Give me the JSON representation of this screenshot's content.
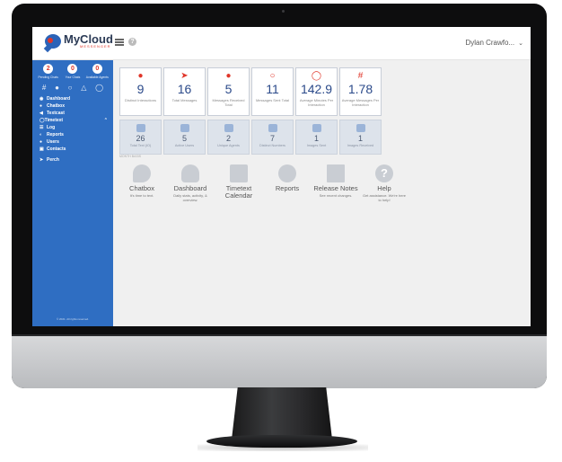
{
  "app": {
    "logo_title": "MyCloud",
    "logo_subtitle": "MESSENGER",
    "user_name": "Dylan Crawfo..."
  },
  "sidebar": {
    "counters": [
      {
        "value": "2",
        "label": "Pending Chats"
      },
      {
        "value": "0",
        "label": "Your Chats"
      },
      {
        "value": "0",
        "label": "Available Agents"
      }
    ],
    "icons": [
      "hash-icon",
      "user-icon",
      "chat-icon",
      "warning-icon",
      "clock-icon"
    ],
    "items": [
      {
        "label": "Dashboard",
        "icon": "dashboard-icon"
      },
      {
        "label": "Chatbox",
        "icon": "chat-icon"
      },
      {
        "label": "Textcast",
        "icon": "megaphone-icon"
      },
      {
        "label": "Timetext",
        "icon": "clock-icon"
      },
      {
        "label": "Log",
        "icon": "list-icon"
      },
      {
        "label": "Reports",
        "icon": "chart-icon"
      },
      {
        "label": "Users",
        "icon": "users-icon"
      },
      {
        "label": "Contacts",
        "icon": "contacts-icon"
      },
      {
        "label": "Perch",
        "icon": "bird-icon"
      }
    ],
    "copyright": "© 2021. All rights reserved."
  },
  "stats": [
    {
      "value": "9",
      "label": "Distinct Interactions",
      "icon": "chat-icon"
    },
    {
      "value": "16",
      "label": "Total Messages",
      "icon": "send-icon"
    },
    {
      "value": "5",
      "label": "Messages Received Total",
      "icon": "chat-icon"
    },
    {
      "value": "11",
      "label": "Messages Sent Total",
      "icon": "chat-outline-icon"
    },
    {
      "value": "142.9",
      "label": "Average Minutes Per Interaction",
      "icon": "clock-icon"
    },
    {
      "value": "1.78",
      "label": "Average Messages Per Interaction",
      "icon": "hash-icon"
    }
  ],
  "stats2": [
    {
      "value": "26",
      "label": "Total Text (IO)"
    },
    {
      "value": "5",
      "label": "Active Users"
    },
    {
      "value": "2",
      "label": "Unique Agents"
    },
    {
      "value": "7",
      "label": "Distinct Numbers"
    },
    {
      "value": "1",
      "label": "Images Sent"
    },
    {
      "value": "1",
      "label": "Images Received"
    }
  ],
  "month_basis": "MONTH BASIS",
  "shortcuts": [
    {
      "title": "Chatbox",
      "sub": "It's time to text."
    },
    {
      "title": "Dashboard",
      "sub": "Daily stats, activity, & overview."
    },
    {
      "title": "Timetext Calendar",
      "sub": ""
    },
    {
      "title": "Reports",
      "sub": ""
    },
    {
      "title": "Release Notes",
      "sub": "See recent changes."
    },
    {
      "title": "Help",
      "sub": "Get assistance. We're here to help!"
    }
  ]
}
